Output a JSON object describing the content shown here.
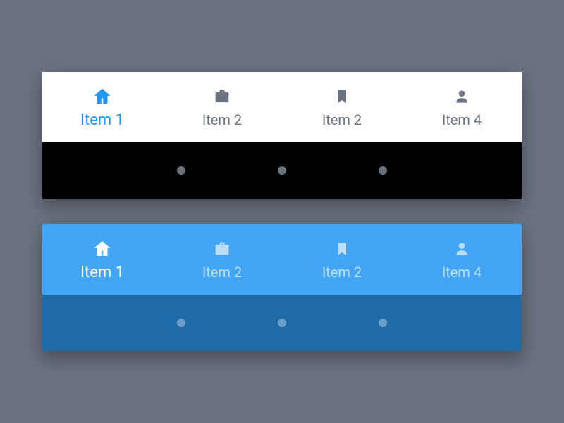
{
  "variants": [
    {
      "theme": "light",
      "items": [
        {
          "label": "Item 1",
          "icon": "home",
          "active": true
        },
        {
          "label": "Item 2",
          "icon": "briefcase",
          "active": false
        },
        {
          "label": "Item 2",
          "icon": "bookmark",
          "active": false
        },
        {
          "label": "Item 4",
          "icon": "person",
          "active": false
        }
      ]
    },
    {
      "theme": "blue",
      "items": [
        {
          "label": "Item 1",
          "icon": "home",
          "active": true
        },
        {
          "label": "Item 2",
          "icon": "briefcase",
          "active": false
        },
        {
          "label": "Item 2",
          "icon": "bookmark",
          "active": false
        },
        {
          "label": "Item 4",
          "icon": "person",
          "active": false
        }
      ]
    }
  ]
}
